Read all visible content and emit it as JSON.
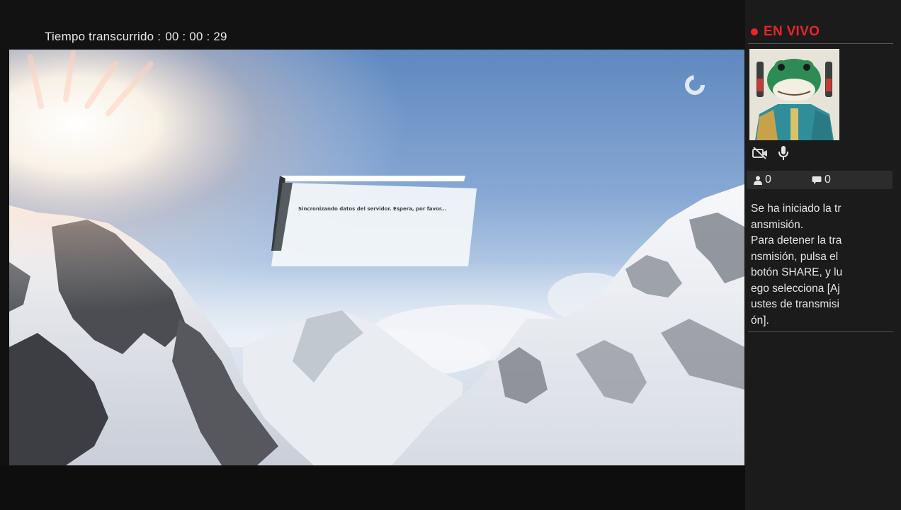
{
  "header": {
    "elapsed_label": "Tiempo transcurrido :",
    "elapsed_value": "00 : 00 : 29"
  },
  "game": {
    "dialog_text": "Sincronizando datos del servidor. Espera, por favor..."
  },
  "side_panel": {
    "live_label": "EN VIVO",
    "live_color": "#e8262a",
    "viewers": "0",
    "comments": "0",
    "message_lines": [
      "Se ha iniciado la tr",
      "ansmisión.",
      "Para detener la tra",
      "nsmisión, pulsa el",
      "botón SHARE, y lu",
      "ego selecciona [Aj",
      "ustes de transmisi",
      "ón]."
    ]
  },
  "icons": {
    "loading": "loading-spinner-icon",
    "camera": "camera-off-icon",
    "microphone": "microphone-icon",
    "viewers": "person-icon",
    "comments": "speech-bubble-icon"
  }
}
